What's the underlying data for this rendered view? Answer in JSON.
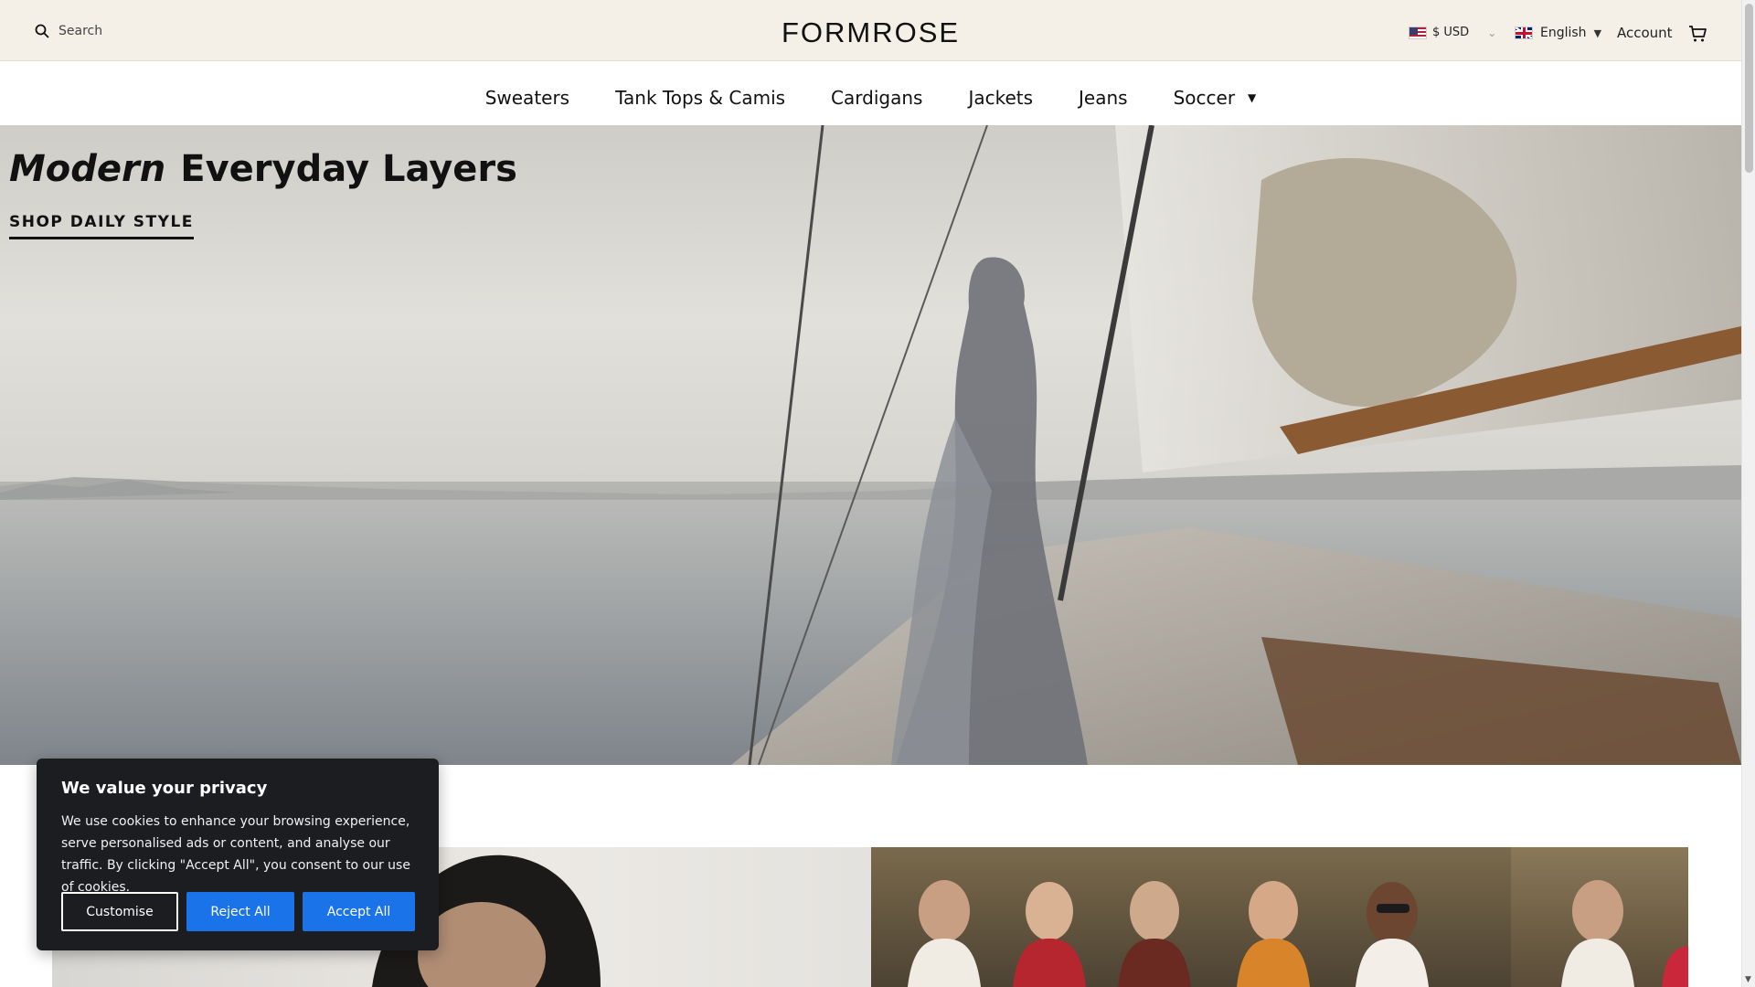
{
  "header": {
    "search_placeholder": "Search",
    "brand": "FORMROSE",
    "currency": "$ USD",
    "language": "English",
    "account": "Account"
  },
  "nav": {
    "items": [
      {
        "label": "Sweaters"
      },
      {
        "label": "Tank Tops & Camis"
      },
      {
        "label": "Cardigans"
      },
      {
        "label": "Jackets"
      },
      {
        "label": "Jeans"
      },
      {
        "label": "Soccer"
      }
    ]
  },
  "hero": {
    "title_em": "Modern",
    "title_rest": "Everyday Layers",
    "cta": "SHOP DAILY STYLE"
  },
  "cookie": {
    "title": "We value your privacy",
    "body": "We use cookies to enhance your browsing experience, serve personalised ads or content, and analyse our traffic. By clicking \"Accept All\", you consent to our use of cookies.",
    "customise": "Customise",
    "reject": "Reject All",
    "accept": "Accept All"
  },
  "icons": {
    "search": "search-icon",
    "cart": "cart-icon",
    "currency_flag": "us-flag-icon",
    "language_flag": "uk-flag-icon"
  },
  "colors": {
    "topbar_bg": "#f4efe7",
    "button_blue": "#1a73e8",
    "cookie_bg": "#1b1d21"
  }
}
